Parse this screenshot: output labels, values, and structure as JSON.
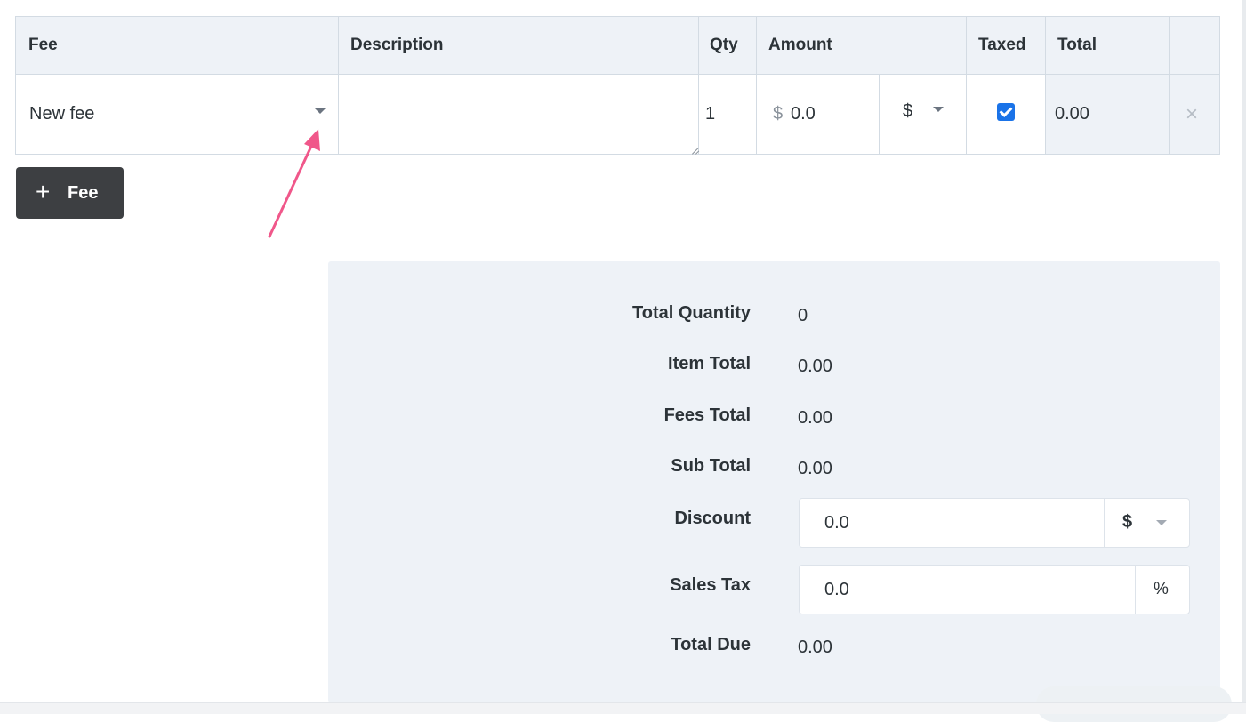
{
  "fee_table": {
    "headers": {
      "fee": "Fee",
      "description": "Description",
      "qty": "Qty",
      "amount": "Amount",
      "taxed": "Taxed",
      "total": "Total"
    },
    "row": {
      "fee_selected": "New fee",
      "description": "",
      "qty": "1",
      "amount_prefix": "$",
      "amount": "0.0",
      "amount_unit": "$",
      "taxed": true,
      "total": "0.00",
      "remove_symbol": "×"
    }
  },
  "add_fee_button": {
    "icon": "+",
    "label": "Fee"
  },
  "totals": {
    "total_quantity": {
      "label": "Total Quantity",
      "value": "0"
    },
    "item_total": {
      "label": "Item Total",
      "value": "0.00"
    },
    "fees_total": {
      "label": "Fees Total",
      "value": "0.00"
    },
    "sub_total": {
      "label": "Sub Total",
      "value": "0.00"
    },
    "discount": {
      "label": "Discount",
      "value": "0.0",
      "unit": "$"
    },
    "sales_tax": {
      "label": "Sales Tax",
      "value": "0.0",
      "unit": "%"
    },
    "total_due": {
      "label": "Total Due",
      "value": "0.00"
    }
  },
  "annotation": {
    "arrow_color": "#f0578a"
  },
  "colors": {
    "header_bg": "#eef2f7",
    "panel_bg": "#eef2f7",
    "button_bg": "#3d3f42",
    "checkbox": "#1a73e8"
  }
}
